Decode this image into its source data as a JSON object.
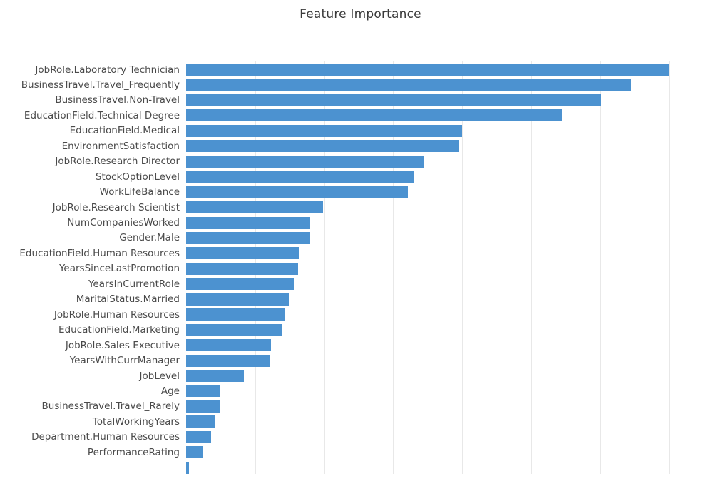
{
  "chart_data": {
    "type": "bar",
    "orientation": "horizontal",
    "title": "Feature Importance",
    "xlabel": "",
    "ylabel": "",
    "grid": true,
    "gridlines_axis": "x",
    "legend": "none",
    "bar_color": "#4c92d0",
    "title_color": "#3a3a3a",
    "tick_label_color": "#4a4a4a",
    "gridline_color": "#e8e8e8",
    "background_color": "#ffffff",
    "xlim": [
      0,
      0.0775
    ],
    "x_tick_values": [
      0,
      0.01,
      0.02,
      0.03,
      0.04,
      0.05,
      0.06,
      0.07
    ],
    "x_tick_labels_visible": false,
    "note": "Chart is cropped at the bottom; a 27th bar is partially visible below PerformanceRating. Long y tick labels are clipped at the left image edge.",
    "categories": [
      "JobRole.Laboratory Technician",
      "BusinessTravel.Travel_Frequently",
      "BusinessTravel.Non-Travel",
      "EducationField.Technical Degree",
      "EducationField.Medical",
      "EnvironmentSatisfaction",
      "JobRole.Research Director",
      "StockOptionLevel",
      "WorkLifeBalance",
      "JobRole.Research Scientist",
      "NumCompaniesWorked",
      "Gender.Male",
      "EducationField.Human Resources",
      "YearsSinceLastPromotion",
      "YearsInCurrentRole",
      "MaritalStatus.Married",
      "JobRole.Human Resources",
      "EducationField.Marketing",
      "JobRole.Sales Executive",
      "YearsWithCurrManager",
      "JobLevel",
      "Age",
      "BusinessTravel.Travel_Rarely",
      "TotalWorkingYears",
      "Department.Human Resources",
      "PerformanceRating"
    ],
    "values": [
      0.07,
      0.0645,
      0.0601,
      0.0544,
      0.04,
      0.0396,
      0.0345,
      0.033,
      0.0321,
      0.0198,
      0.018,
      0.0179,
      0.0163,
      0.0162,
      0.0156,
      0.0149,
      0.0144,
      0.0138,
      0.0123,
      0.0122,
      0.0084,
      0.0048,
      0.0048,
      0.0041,
      0.0036,
      0.0024
    ],
    "value_unit": "importance",
    "sort_order": "descending"
  }
}
